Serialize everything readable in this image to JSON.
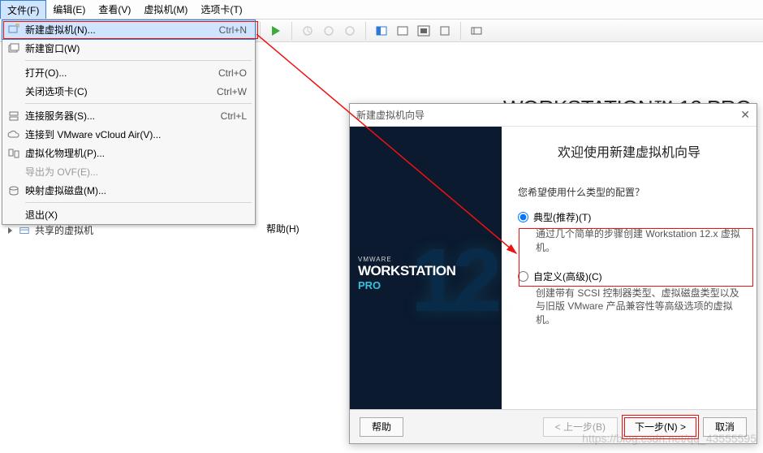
{
  "menubar": {
    "file": "文件(F)",
    "edit": "编辑(E)",
    "view": "查看(V)",
    "vm": "虚拟机(M)",
    "tabs": "选项卡(T)",
    "help": "帮助(H)"
  },
  "dropdown": {
    "new_vm": "新建虚拟机(N)...",
    "new_vm_sc": "Ctrl+N",
    "new_window": "新建窗口(W)",
    "open": "打开(O)...",
    "open_sc": "Ctrl+O",
    "close_tab": "关闭选项卡(C)",
    "close_tab_sc": "Ctrl+W",
    "connect_server": "连接服务器(S)...",
    "connect_server_sc": "Ctrl+L",
    "connect_vcloud": "连接到 VMware vCloud Air(V)...",
    "virtualize_physical": "虚拟化物理机(P)...",
    "export_ovf": "导出为 OVF(E)...",
    "map_disk": "映射虚拟磁盘(M)...",
    "exit": "退出(X)"
  },
  "sidebar": {
    "shared": "共享的虚拟机"
  },
  "bg_title": "WORKSTATION 12 PRO",
  "wizard": {
    "title": "新建虚拟机向导",
    "close": "✕",
    "brand_vm": "VMWARE",
    "brand_ws": "WORKSTATION",
    "brand_pro": "PRO",
    "big": "12",
    "heading": "欢迎使用新建虚拟机向导",
    "question": "您希望使用什么类型的配置？",
    "opt1_label": "典型(推荐)(T)",
    "opt1_desc": "通过几个简单的步骤创建 Workstation 12.x 虚拟机。",
    "opt2_label": "自定义(高级)(C)",
    "opt2_desc": "创建带有 SCSI 控制器类型、虚拟磁盘类型以及与旧版 VMware 产品兼容性等高级选项的虚拟机。",
    "btn_help": "帮助",
    "btn_back": "< 上一步(B)",
    "btn_next": "下一步(N) >",
    "btn_cancel": "取消"
  }
}
